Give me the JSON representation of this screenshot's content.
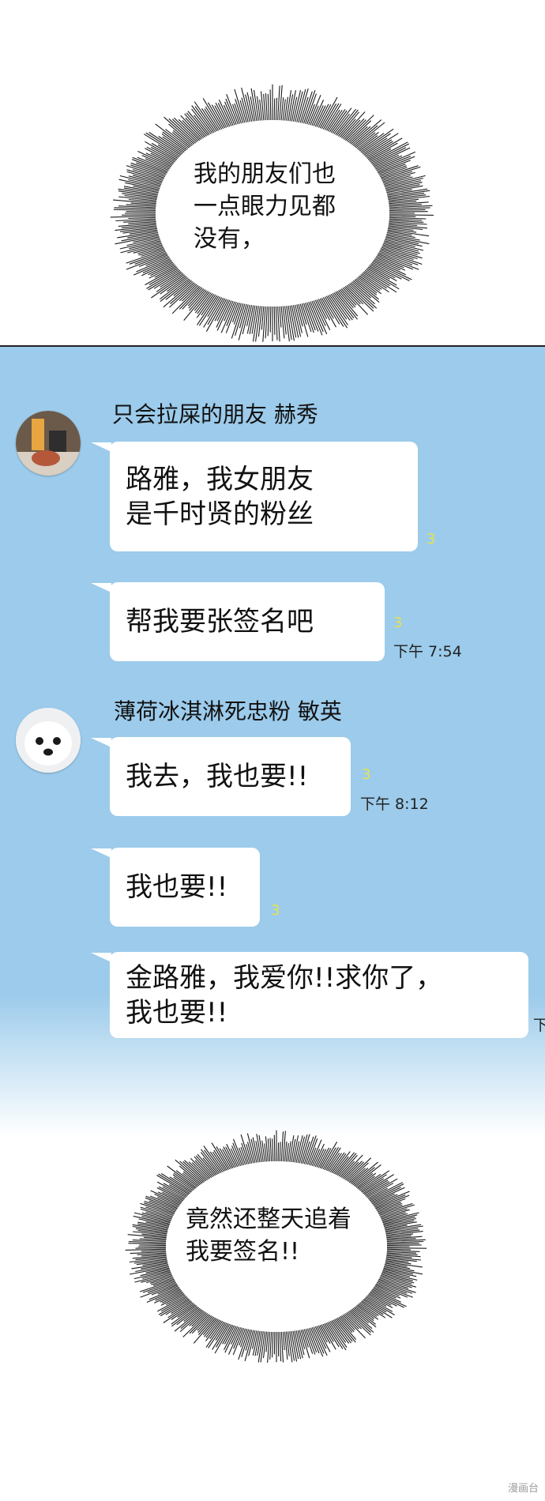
{
  "bursts": {
    "top_text": "我的朋友们也\n一点眼力见都\n没有，",
    "bottom_text": "竟然还整天追着\n我要签名!!"
  },
  "chat": {
    "groups": [
      {
        "sender": "只会拉屎的朋友 赫秀",
        "messages": [
          {
            "text": "路雅，我女朋友\n是千时贤的粉丝",
            "read": "3",
            "time": ""
          },
          {
            "text": "帮我要张签名吧",
            "read": "3",
            "time": "下午  7:54"
          }
        ]
      },
      {
        "sender": "薄荷冰淇淋死忠粉 敏英",
        "messages": [
          {
            "text": "我去，我也要!!",
            "read": "3",
            "time": "下午  8:12"
          },
          {
            "text": "我也要!!",
            "read": "3",
            "time": ""
          },
          {
            "text": "金路雅，我爱你!!求你了，\n我也要!!",
            "read": "",
            "time": "下"
          }
        ]
      }
    ]
  },
  "watermark": "漫画台"
}
